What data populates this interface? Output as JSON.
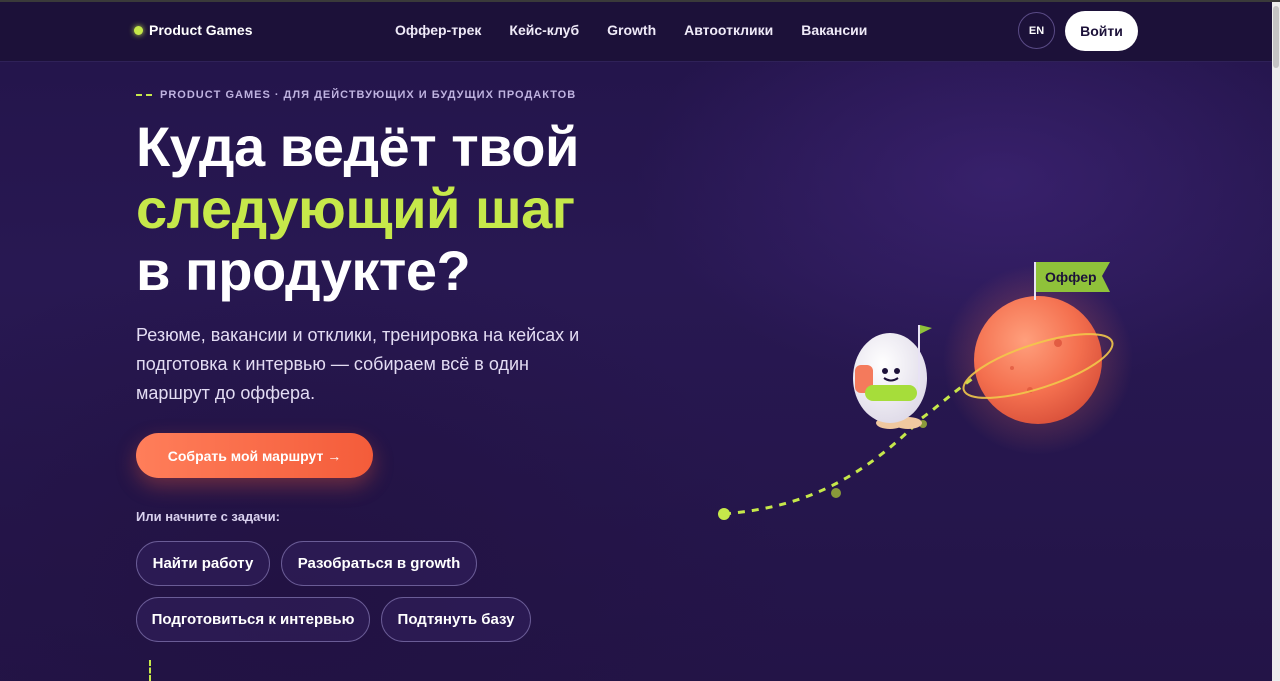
{
  "header": {
    "logo": "Product Games",
    "nav": [
      "Оффер-трек",
      "Кейс-клуб",
      "Growth",
      "Автоотклики",
      "Вакансии"
    ],
    "lang": "EN",
    "login": "Войти"
  },
  "hero": {
    "eyebrow": "PRODUCT GAMES · ДЛЯ ДЕЙСТВУЮЩИХ И БУДУЩИХ ПРОДАКТОВ",
    "title_line1": "Куда ведёт твой",
    "title_line2": "следующий шаг",
    "title_line3": "в продукте?",
    "lead": "Резюме, вакансии и отклики, тренировка на кейсах и подготовка к интервью — собираем всё в один маршрут до оффера.",
    "cta": "Собрать мой маршрут →",
    "tasks_label": "Или начните с задачи:",
    "tasks": [
      "Найти работу",
      "Разобраться в growth",
      "Подготовиться к интервью",
      "Подтянуть базу"
    ]
  },
  "illustration": {
    "flag_label": "Оффер"
  },
  "colors": {
    "background": "#241546",
    "accent": "#c6e84a",
    "cta": "#f45c3a",
    "planet": "#f47a5c"
  }
}
